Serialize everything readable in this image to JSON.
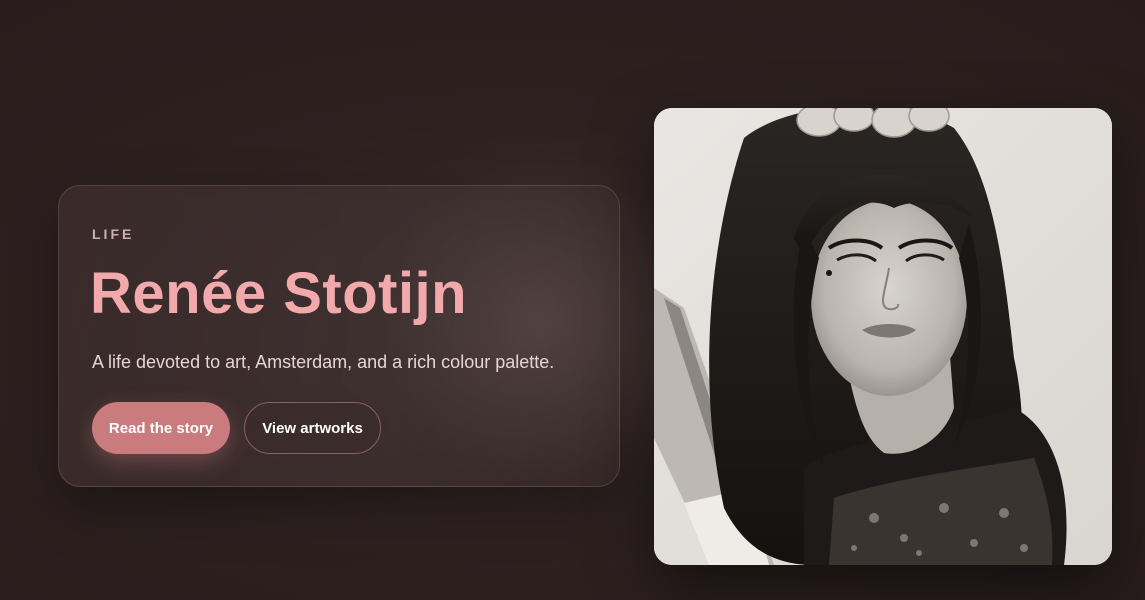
{
  "hero": {
    "eyebrow": "LIFE",
    "title": "Renée Stotijn",
    "subtitle": "A life devoted to art, Amsterdam, and a rich colour palette.",
    "primary_button": "Read the story",
    "secondary_button": "View artworks"
  },
  "portrait": {
    "alt": "Black and white portrait photograph of Renée Stotijn"
  },
  "colors": {
    "background": "#2d2120",
    "accent": "#f1a9ac",
    "button_primary": "#c97b7d",
    "button_border": "#8a5f5f"
  }
}
